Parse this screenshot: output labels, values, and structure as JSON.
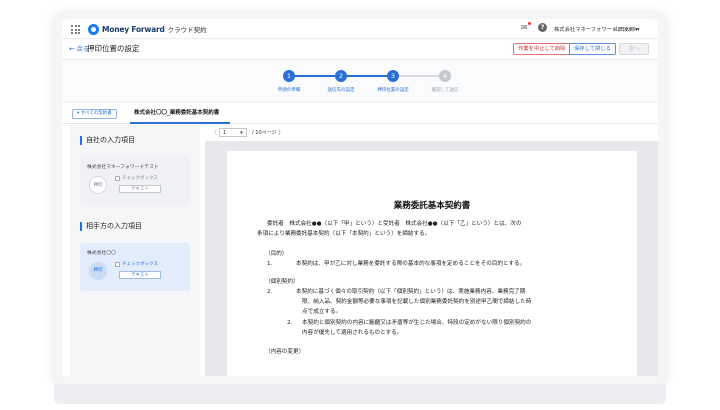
{
  "app": {
    "logo_text": "Money Forward",
    "logo_sub": "クラウド契約",
    "org_name": "株式会社マネーフォワードテスト ▾",
    "user_name": "山田太郎 ▾",
    "help_icon": "?"
  },
  "header": {
    "back_label": "戻る",
    "page_title": "押印位置の設定",
    "cancel_label": "作業を中止して削除",
    "save_label": "保存して閉じる",
    "next_label": "次へ"
  },
  "steps": [
    {
      "num": "1",
      "label": "申請の準備"
    },
    {
      "num": "2",
      "label": "送信先の設定"
    },
    {
      "num": "3",
      "label": "押印位置の設定"
    },
    {
      "num": "4",
      "label": "確認して送信"
    }
  ],
  "tabs": {
    "all_contracts": "▾ すべての契約書",
    "current_doc": "株式会社〇〇_業務委託基本契約書"
  },
  "left_panel": {
    "own_section": "自社の入力項目",
    "own_company": "株式会社マネーフォワードテスト",
    "other_section": "相手方の入力項目",
    "other_company": "株式会社〇〇",
    "stamp_label": "押印",
    "checkbox_label": "チェックボックス",
    "text_label": "テキスト"
  },
  "pager": {
    "prev": "〈",
    "current": "1",
    "total": "/ 10ページ",
    "next": "〉"
  },
  "document": {
    "title": "業務委託基本契約書",
    "lines": [
      "委託者　株式会社●●（以下「甲」という）と受託者　株式会社●●（以下「乙」という）とは、次の",
      "条項により業務委託基本契約（以下「本契約」という）を締結する。",
      "（目的）",
      "本契約は、甲が乙に対し業務を委託する際の基本的な事項を定めることをその目的とする。",
      "（個別契約）",
      "本契約に基づく個々の取引契約（以下「個別契約」という）は、実施業務内容、業務完了期",
      "限、納入品、契約金額等必要な事項を記載した個別業務委託契約を別途甲乙間で締結した時",
      "点で成立する。",
      "本契約と個別契約の内容に齟齬又は矛盾等が生じた場合、特段の定めがない限り個別契約の",
      "内容が優先して適用されるものとする。",
      "（内容の変更）"
    ],
    "num_1": "1.",
    "num_2": "2.",
    "num_2b": "2."
  }
}
